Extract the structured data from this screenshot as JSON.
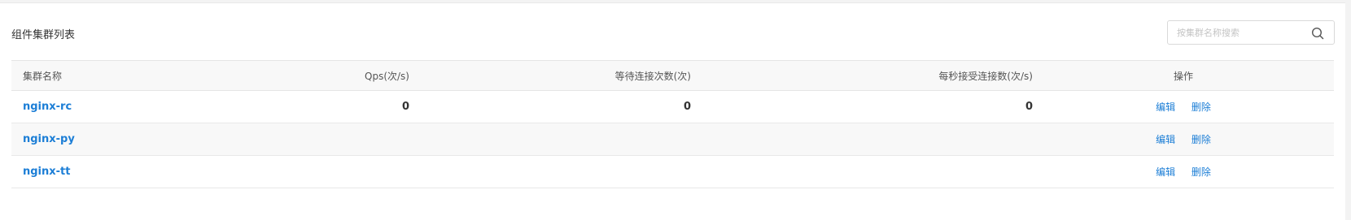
{
  "panel": {
    "title": "组件集群列表"
  },
  "search": {
    "placeholder": "按集群名称搜索",
    "value": "",
    "icon": "search-icon"
  },
  "table": {
    "headers": {
      "name": "集群名称",
      "qps": "Qps(次/s)",
      "waiting": "等待连接次数(次)",
      "accept_rate": "每秒接受连接数(次/s)",
      "actions": "操作"
    },
    "rows": [
      {
        "name": "nginx-rc",
        "qps": "0",
        "waiting": "0",
        "accept_rate": "0",
        "edit": "编辑",
        "delete": "删除"
      },
      {
        "name": "nginx-py",
        "qps": "",
        "waiting": "",
        "accept_rate": "",
        "edit": "编辑",
        "delete": "删除"
      },
      {
        "name": "nginx-tt",
        "qps": "",
        "waiting": "",
        "accept_rate": "",
        "edit": "编辑",
        "delete": "删除"
      }
    ]
  },
  "colors": {
    "link": "#1c7ed6",
    "header_bg": "#f8f8f8",
    "border": "#e5e5e5"
  }
}
